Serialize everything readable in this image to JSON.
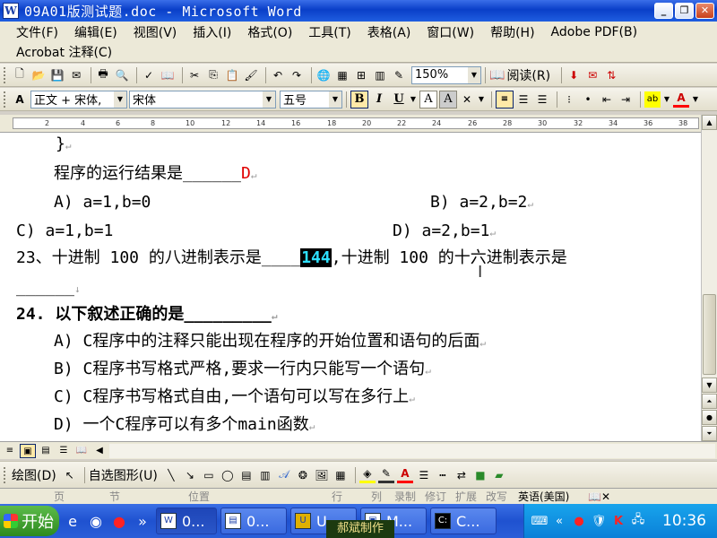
{
  "window": {
    "title": "09A01版测试题.doc - Microsoft Word",
    "icon": "W"
  },
  "menu": {
    "items": [
      "文件(F)",
      "编辑(E)",
      "视图(V)",
      "插入(I)",
      "格式(O)",
      "工具(T)",
      "表格(A)",
      "窗口(W)",
      "帮助(H)",
      "Adobe PDF(B)"
    ],
    "row2": "Acrobat 注释(C)"
  },
  "toolbar": {
    "zoom": "150%",
    "read_label": "阅读(R)"
  },
  "format": {
    "style": "正文 + 宋体,",
    "font": "宋体",
    "size": "五号"
  },
  "ruler": {
    "ticks": [
      "2",
      "4",
      "6",
      "8",
      "10",
      "12",
      "14",
      "16",
      "18",
      "20",
      "22",
      "24",
      "26",
      "28",
      "30",
      "32",
      "34",
      "36",
      "38"
    ]
  },
  "document": {
    "l1": "}",
    "l2_prefix": "程序的运行结果是______",
    "l2_answer": "D",
    "l3_a": "A) a=1,b=0",
    "l3_b": "B) a=2,b=2",
    "l4_c": "C) a=1,b=1",
    "l4_d": "D) a=2,b=1",
    "q23_prefix": "23、十进制 100 的八进制表示是____",
    "q23_answer": "144",
    "q23_suffix": ",十进制 100 的十六进制表示是",
    "q23_blank": "______",
    "q24": "24. 以下叙述正确的是_________",
    "q24_a": "A) C程序中的注释只能出现在程序的开始位置和语句的后面",
    "q24_b": "B) C程序书写格式严格,要求一行内只能写一个语句",
    "q24_c": "C) C程序书写格式自由,一个语句可以写在多行上",
    "q24_d": "D) 一个C程序可以有多个main函数"
  },
  "drawing": {
    "draw_label": "绘图(D)",
    "autoshape_label": "自选图形(U)"
  },
  "status": {
    "page": "页",
    "section": "节",
    "position": "位置",
    "line": "行",
    "col": "列",
    "rec": "录制",
    "trk": "修订",
    "ext": "扩展",
    "ovr": "改写",
    "lang": "英语(美国)"
  },
  "taskbar": {
    "start": "开始",
    "tasks": [
      "0...",
      "0...",
      "U...",
      "M...",
      "C..."
    ],
    "time": "10:36",
    "watermark": "郝斌制作"
  }
}
